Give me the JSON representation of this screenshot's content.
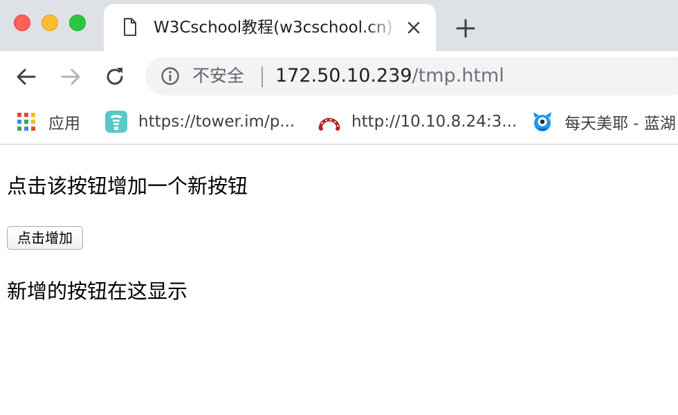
{
  "tab": {
    "title": "W3Cschool教程(w3cschool.cn)",
    "favicon": "document-icon"
  },
  "toolbar": {
    "back": "back-arrow-icon",
    "forward": "forward-arrow-icon",
    "reload": "reload-icon",
    "security_label": "不安全",
    "url_host": "172.50.10.239",
    "url_path": "/tmp.html"
  },
  "bookmarks": [
    {
      "label": "应用",
      "icon": "apps-grid-icon"
    },
    {
      "label": "https://tower.im/p...",
      "icon": "tower-icon"
    },
    {
      "label": "http://10.10.8.24:3...",
      "icon": "jenkins-arc-icon"
    },
    {
      "label": "每天美耶 - 蓝湖",
      "icon": "lanhu-monster-icon"
    }
  ],
  "page": {
    "heading": "点击该按钮增加一个新按钮",
    "button_label": "点击增加",
    "note": "新增的按钮在这显示"
  },
  "colors": {
    "tabstrip_bg": "#dee1e6",
    "omnibox_bg": "#f1f3f4",
    "close_red": "#fe5f57",
    "minimize_yellow": "#febc2e",
    "zoom_green": "#29c840"
  }
}
